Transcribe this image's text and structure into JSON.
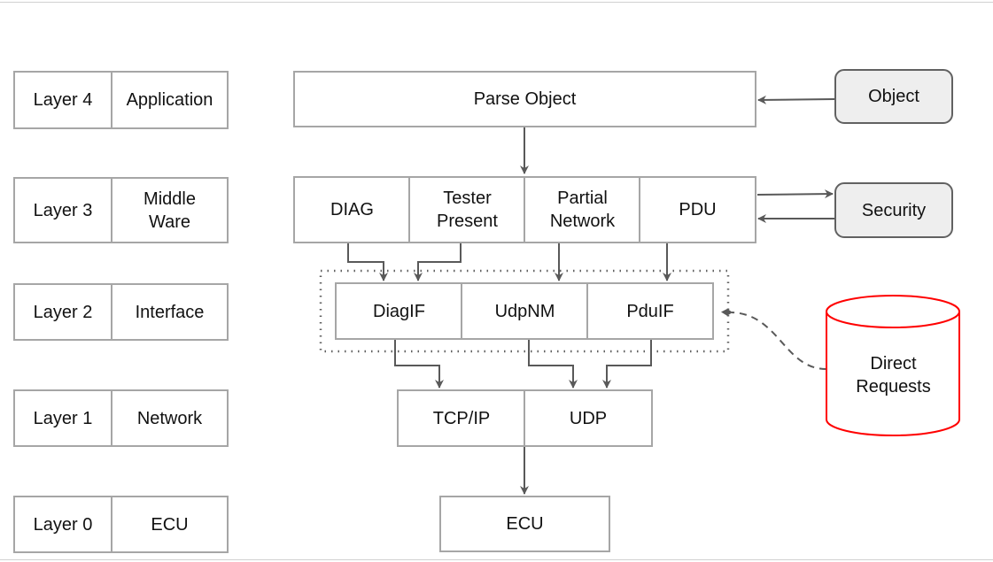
{
  "layers": [
    {
      "level": "Layer 4",
      "name": "Application"
    },
    {
      "level": "Layer 3",
      "name": "Middle\nWare"
    },
    {
      "level": "Layer 2",
      "name": "Interface"
    },
    {
      "level": "Layer 1",
      "name": "Network"
    },
    {
      "level": "Layer 0",
      "name": "ECU"
    }
  ],
  "layer4": {
    "parse": "Parse Object"
  },
  "layer3": [
    "DIAG",
    "Tester\nPresent",
    "Partial\nNetwork",
    "PDU"
  ],
  "layer2": [
    "DiagIF",
    "UdpNM",
    "PduIF"
  ],
  "layer1": [
    "TCP/IP",
    "UDP"
  ],
  "layer0": {
    "ecu": "ECU"
  },
  "external": {
    "object": "Object",
    "security": "Security",
    "direct_requests": "Direct\nRequests"
  },
  "colors": {
    "box_border": "#a6a6a6",
    "arrow": "#595959",
    "external_fill": "#eeeeee",
    "cylinder": "#ff0000"
  }
}
